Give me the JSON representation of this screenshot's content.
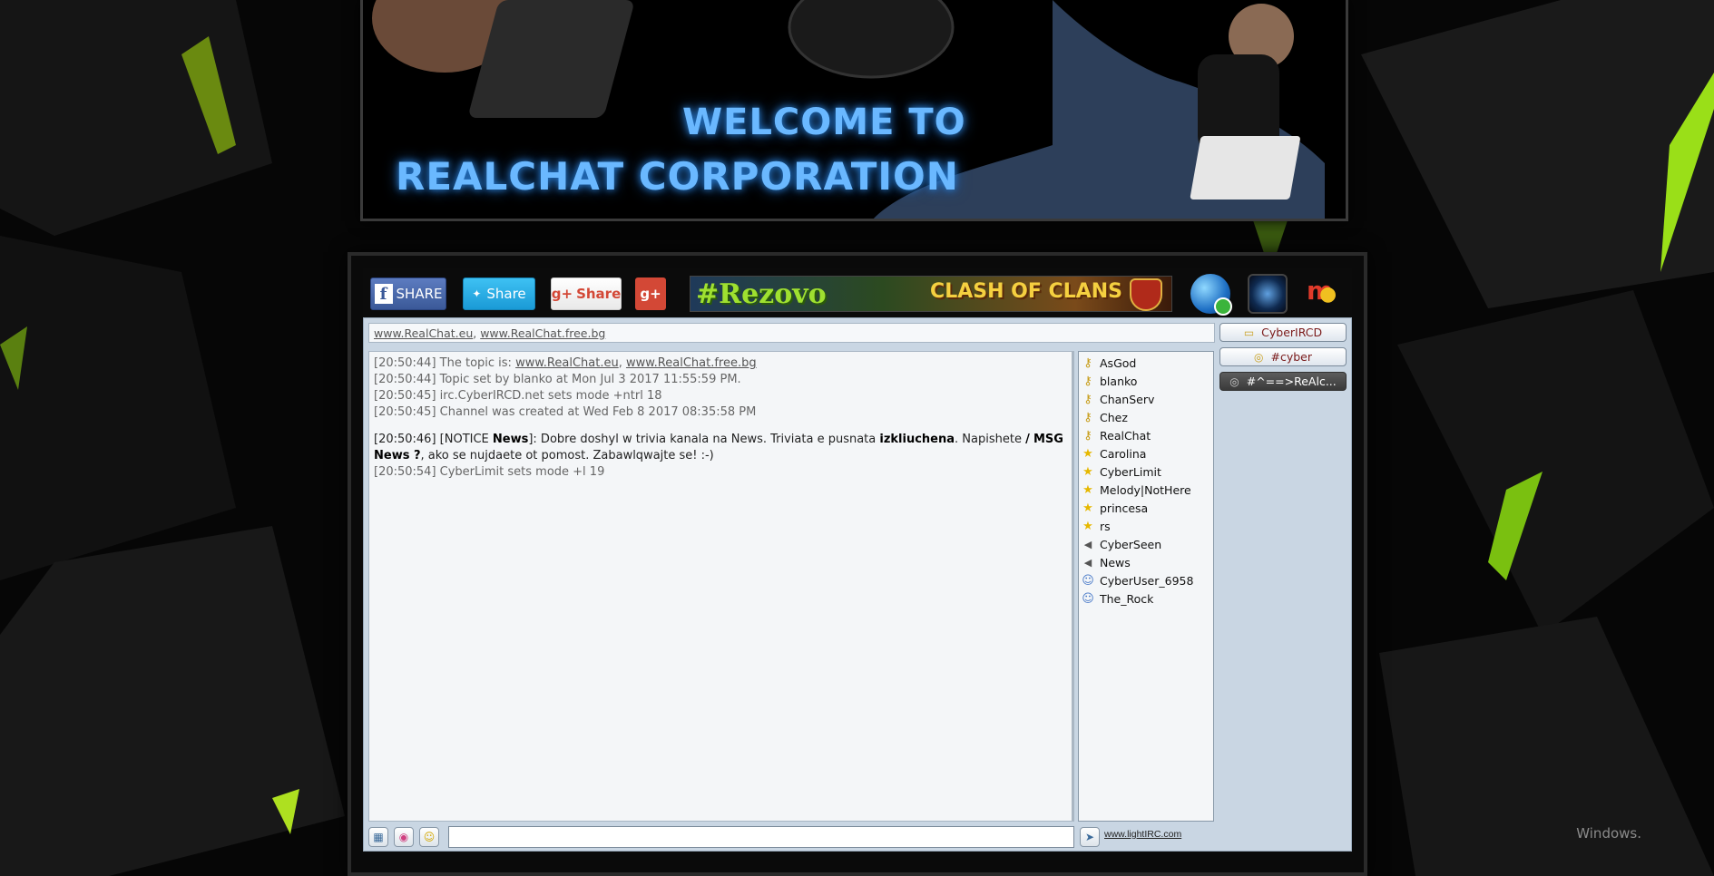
{
  "banner": {
    "welcome_line1": "WELCOME TO",
    "welcome_line2": "REALCHAT CORPORATION"
  },
  "sharebar": {
    "facebook_label": "SHARE",
    "twitter_label": "Share",
    "googleplus_label": "Share",
    "google_label": "g+",
    "ad_left": "#Rezovo",
    "ad_right": "CLASH OF CLANS"
  },
  "topic_bar": {
    "link1": "www.RealChat.eu",
    "separator": ", ",
    "link2": "www.RealChat.free.bg"
  },
  "messages": {
    "m1_prefix": "[20:50:44] The topic is: ",
    "m1_link1": "www.RealChat.eu",
    "m1_sep": ", ",
    "m1_link2": "www.RealChat.free.bg",
    "m2": "[20:50:44] Topic set by blanko at Mon Jul 3 2017 11:55:59 PM.",
    "m3": "[20:50:45] irc.CyberIRCD.net sets mode +ntrl 18",
    "m4": "[20:50:45] Channel was created at Wed Feb 8 2017 08:35:58 PM",
    "m5_a": "[20:50:46] [NOTICE ",
    "m5_b": "News",
    "m5_c": "]: Dobre doshyl w trivia kanala na News. Triviata e pusnata ",
    "m5_d": "izkliuchena",
    "m5_e": ". Napishete ",
    "m5_f": "/",
    "m5_g": "MSG News ?",
    "m5_h": ", ako se nujdaete ot pomost. Zabawlqwajte se! :-)",
    "m6": "[20:50:54] CyberLimit sets mode +l 19"
  },
  "users": [
    {
      "name": "AsGod",
      "role": "key-icon"
    },
    {
      "name": "blanko",
      "role": "key-icon"
    },
    {
      "name": "ChanServ",
      "role": "key-icon"
    },
    {
      "name": "Chez",
      "role": "key-icon"
    },
    {
      "name": "RealChat",
      "role": "key-icon"
    },
    {
      "name": "Carolina",
      "role": "star-icon"
    },
    {
      "name": "CyberLimit",
      "role": "star-icon"
    },
    {
      "name": "Melody|NotHere",
      "role": "star-icon"
    },
    {
      "name": "princesa",
      "role": "star-icon"
    },
    {
      "name": "rs",
      "role": "star-icon"
    },
    {
      "name": "CyberSeen",
      "role": "speaker-icon"
    },
    {
      "name": "News",
      "role": "speaker-icon"
    },
    {
      "name": "CyberUser_6958",
      "role": "user-icon"
    },
    {
      "name": "The_Rock",
      "role": "user-icon"
    }
  ],
  "channel_tabs": [
    {
      "label": "CyberIRCD",
      "icon": "note-icon",
      "active": false
    },
    {
      "label": "#cyber",
      "icon": "chat-icon",
      "active": false
    },
    {
      "label": "#^==>ReAlc...",
      "icon": "chat-icon",
      "active": true
    }
  ],
  "input": {
    "value": "",
    "footer_link": "www.lightIRC.com"
  },
  "desktop": {
    "windows_text": "Windows."
  },
  "colors": {
    "panel_bg": "#c9d6e3",
    "tab_text": "#7a1a1a",
    "banner_glow": "#6ab8ff"
  }
}
